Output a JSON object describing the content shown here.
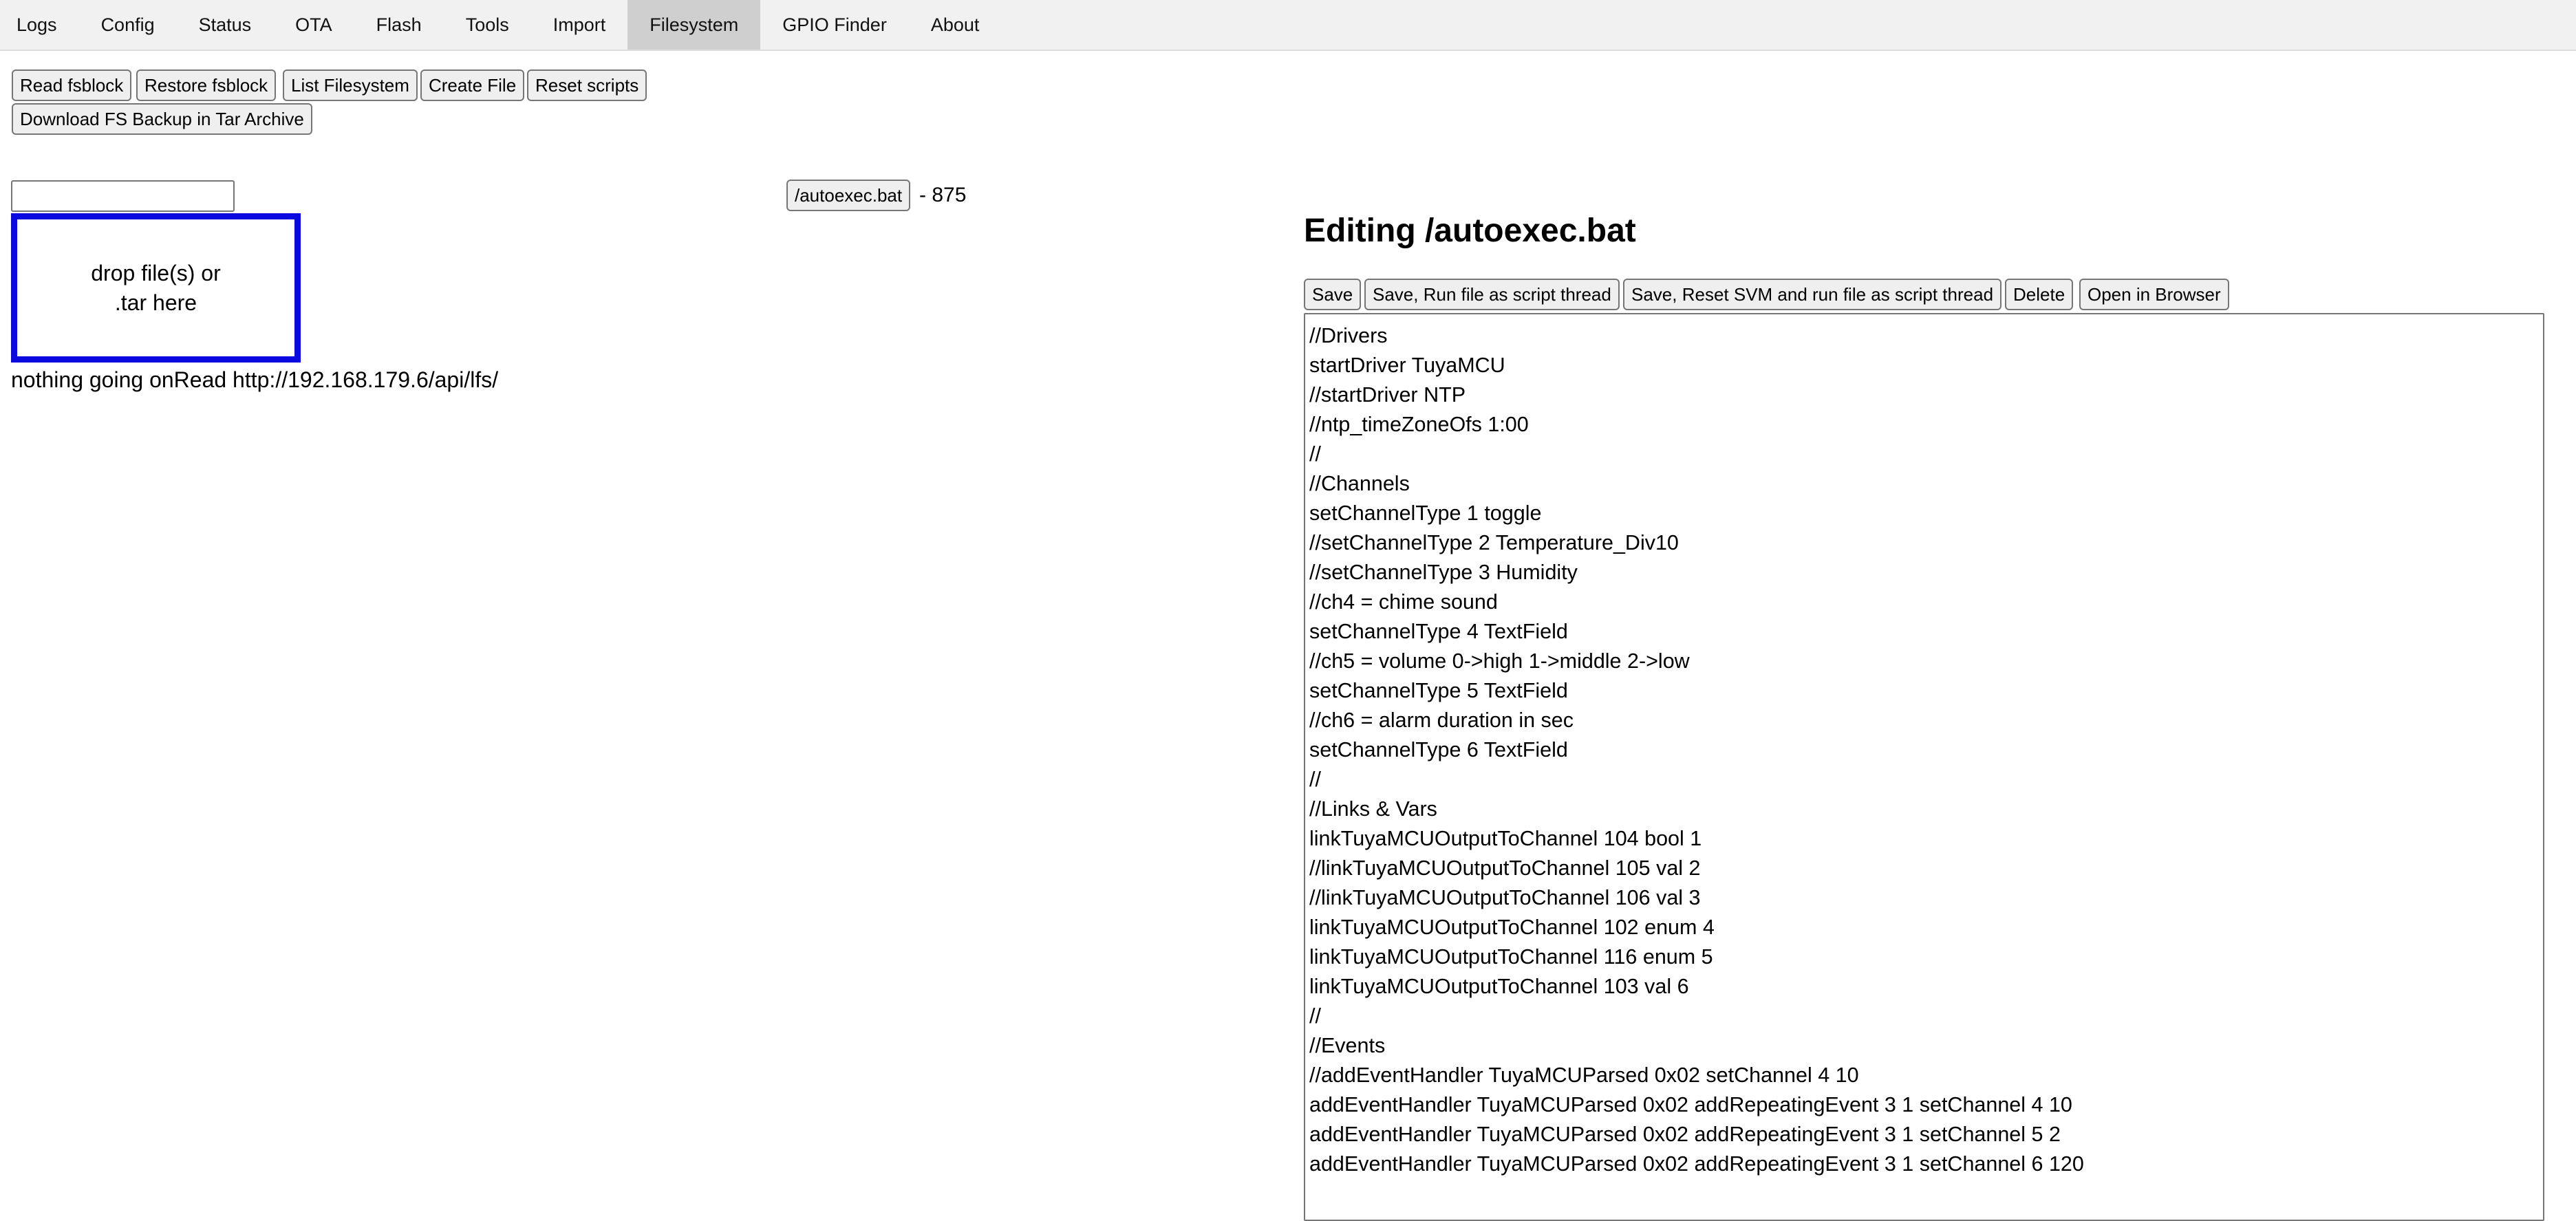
{
  "nav": {
    "tabs": [
      "Logs",
      "Config",
      "Status",
      "OTA",
      "Flash",
      "Tools",
      "Import",
      "Filesystem",
      "GPIO Finder",
      "About"
    ],
    "active_tab": "Filesystem"
  },
  "toolbar": {
    "read_fsblock": "Read fsblock",
    "restore_fsblock": "Restore fsblock",
    "list_filesystem": "List Filesystem",
    "create_file": "Create File",
    "reset_scripts": "Reset scripts",
    "download_backup": "Download FS Backup in Tar Archive"
  },
  "upload": {
    "filename_value": "",
    "dropzone_text": "drop file(s) or\n.tar here",
    "status": "nothing going onRead http://192.168.179.6/api/lfs/"
  },
  "files": [
    {
      "name": "/autoexec.bat",
      "size_text": "- 875"
    }
  ],
  "editor": {
    "title": "Editing /autoexec.bat",
    "buttons": {
      "save": "Save",
      "save_run": "Save, Run file as script thread",
      "save_reset_run": "Save, Reset SVM and run file as script thread",
      "delete": "Delete",
      "open_browser": "Open in Browser"
    },
    "lines": [
      "//Drivers",
      "startDriver TuyaMCU",
      "//startDriver NTP",
      "//ntp_timeZoneOfs 1:00",
      "//",
      "//Channels",
      "setChannelType 1 toggle",
      "//setChannelType 2 Temperature_Div10",
      "//setChannelType 3 Humidity",
      "//ch4 = chime sound",
      "setChannelType 4 TextField",
      "//ch5 = volume 0->high 1->middle 2->low",
      "setChannelType 5 TextField",
      "//ch6 = alarm duration in sec",
      "setChannelType 6 TextField",
      "//",
      "//Links & Vars",
      "linkTuyaMCUOutputToChannel 104 bool 1",
      "//linkTuyaMCUOutputToChannel 105 val 2",
      "//linkTuyaMCUOutputToChannel 106 val 3",
      "linkTuyaMCUOutputToChannel 102 enum 4",
      "linkTuyaMCUOutputToChannel 116 enum 5",
      "linkTuyaMCUOutputToChannel 103 val 6",
      "//",
      "//Events",
      "//addEventHandler TuyaMCUParsed 0x02 setChannel 4 10",
      "addEventHandler TuyaMCUParsed 0x02 addRepeatingEvent 3 1 setChannel 4 10",
      "addEventHandler TuyaMCUParsed 0x02 addRepeatingEvent 3 1 setChannel 5 2",
      "addEventHandler TuyaMCUParsed 0x02 addRepeatingEvent 3 1 setChannel 6 120"
    ]
  },
  "colors": {
    "dropzone_border": "#0a0ae0",
    "nav_background": "#f1f1f1",
    "active_tab_background": "#cfcfcf"
  }
}
